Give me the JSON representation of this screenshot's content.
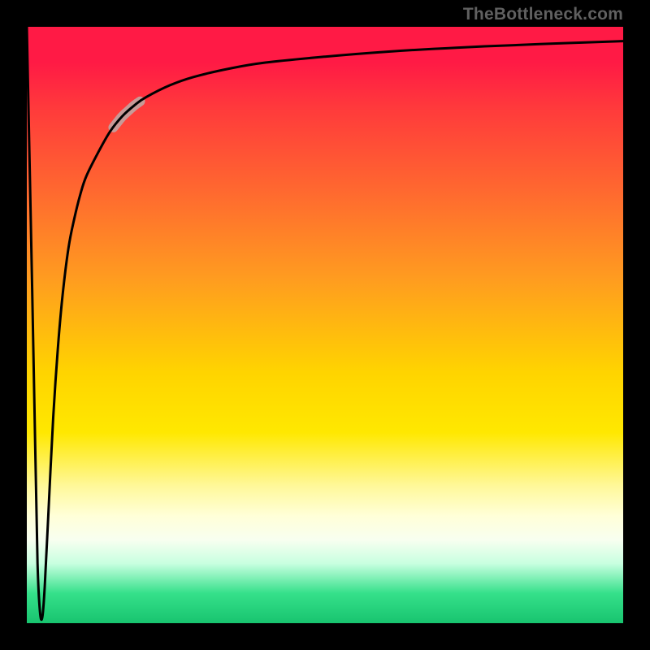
{
  "attribution": "TheBottleneck.com",
  "chart_data": {
    "type": "line",
    "title": "",
    "xlabel": "",
    "ylabel": "",
    "xlim": [
      0,
      100
    ],
    "ylim": [
      0,
      100
    ],
    "grid": false,
    "legend": false,
    "series": [
      {
        "name": "curve",
        "color": "#000000",
        "x": [
          0.0,
          0.9,
          1.4,
          1.8,
          2.2,
          2.6,
          3.0,
          3.6,
          4.4,
          5.2,
          6.0,
          7.0,
          8.0,
          9.0,
          10.0,
          12.0,
          14.0,
          16.0,
          18.0,
          20.0,
          24.0,
          28.0,
          34.0,
          40.0,
          50.0,
          60.0,
          72.0,
          86.0,
          100.0
        ],
        "values": [
          100,
          56,
          30,
          10,
          2,
          1,
          6,
          18,
          34,
          46,
          55,
          63,
          68,
          72,
          75,
          79,
          82.5,
          85,
          86.8,
          88.2,
          90.2,
          91.6,
          93.0,
          94.0,
          95.0,
          95.8,
          96.5,
          97.1,
          97.6
        ]
      }
    ],
    "highlight_segment": {
      "series": "curve",
      "x_start": 14.5,
      "x_end": 19.0,
      "color": "#c79a97",
      "width": 12
    }
  }
}
